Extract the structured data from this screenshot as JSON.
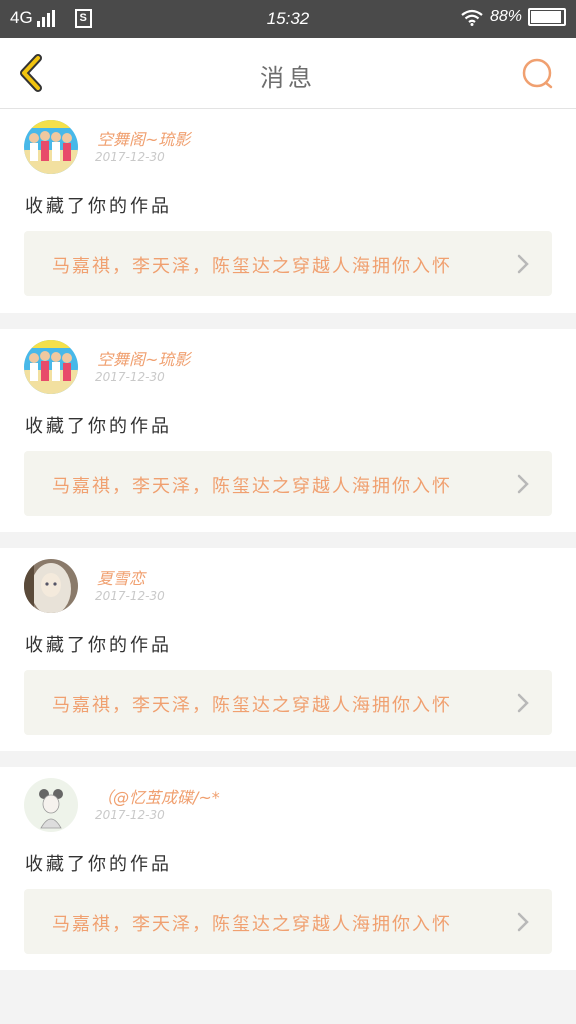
{
  "status_bar": {
    "network": "4G",
    "time": "15:32",
    "battery": "88%"
  },
  "header": {
    "title": "消息",
    "back_icon": "chevron-left-icon",
    "search_icon": "search-icon"
  },
  "colors": {
    "accent": "#f0a070",
    "back_icon_stroke": "#f2c40f",
    "work_box_bg": "#f4f4ee",
    "page_bg": "#f3f3f3"
  },
  "notifications": [
    {
      "user": "空舞阁~琉影",
      "date": "2017-12-30",
      "action": "收藏了你的作品",
      "work_title": "马嘉祺，李天泽，陈玺达之穿越人海拥你入怀",
      "avatar": "group-photo-avatar"
    },
    {
      "user": "空舞阁~琉影",
      "date": "2017-12-30",
      "action": "收藏了你的作品",
      "work_title": "马嘉祺，李天泽，陈玺达之穿越人海拥你入怀",
      "avatar": "group-photo-avatar"
    },
    {
      "user": "夏雪恋",
      "date": "2017-12-30",
      "action": "收藏了你的作品",
      "work_title": "马嘉祺，李天泽，陈玺达之穿越人海拥你入怀",
      "avatar": "doll-avatar"
    },
    {
      "user": "（@忆茧成碟/~*",
      "date": "2017-12-30",
      "action": "收藏了你的作品",
      "work_title": "马嘉祺，李天泽，陈玺达之穿越人海拥你入怀",
      "avatar": "sketch-girl-avatar"
    }
  ]
}
